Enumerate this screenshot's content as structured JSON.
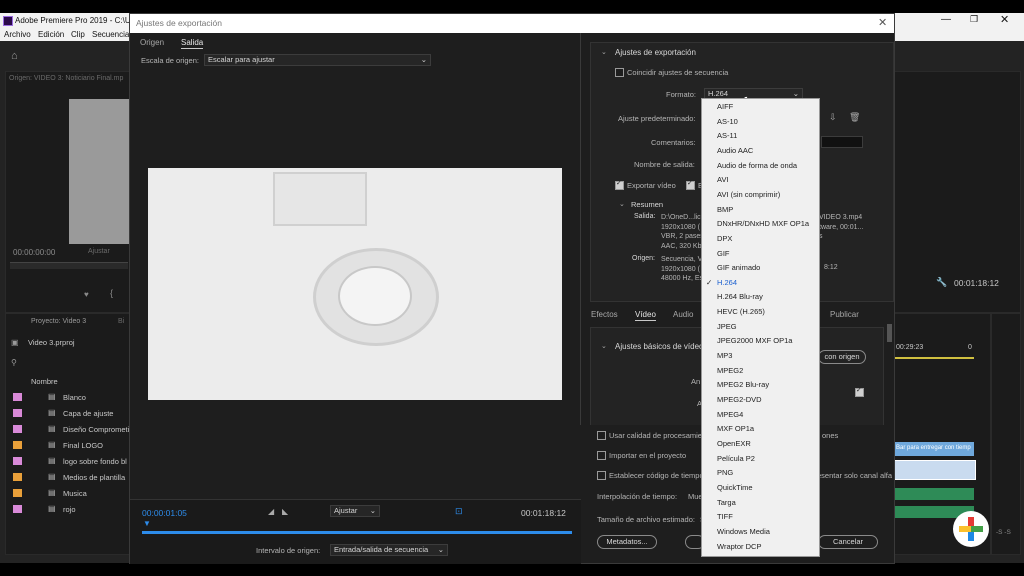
{
  "app": {
    "title": "Adobe Premiere Pro 2019 - C:\\Us",
    "menu": [
      "Archivo",
      "Edición",
      "Clip",
      "Secuencia"
    ],
    "program_monitor_label": "Origen: VIDEO 3: Noticiario Final.mp",
    "timecode_left": "00:00:00:00",
    "fit_left": "Ajustar",
    "timecode_right": "00:01:18:12",
    "project_panel": {
      "tab": "Proyecto: Video 3",
      "tab2": "Bi",
      "file": "Video 3.prproj",
      "column": "Nombre",
      "items": [
        {
          "name": "Blanco",
          "color": "#d98ad8"
        },
        {
          "name": "Capa de ajuste",
          "color": "#d98ad8"
        },
        {
          "name": "Diseño Comprometi",
          "color": "#d98ad8"
        },
        {
          "name": "Final LOGO",
          "color": "#e9a03a"
        },
        {
          "name": "logo sobre fondo bl",
          "color": "#d98ad8"
        },
        {
          "name": "Medios de plantilla",
          "color": "#e9a03a"
        },
        {
          "name": "Musica",
          "color": "#e9a03a"
        },
        {
          "name": "rojo",
          "color": "#d98ad8"
        }
      ]
    },
    "timeline_timecode": "00:29:23",
    "timeline_zero": "0",
    "clip_label": "Bar para entregar con tiemp",
    "meter_value": "-S -S"
  },
  "dialog": {
    "title": "Ajustes de exportación",
    "tabs": [
      "Origen",
      "Salida"
    ],
    "source_scale_label": "Escala de origen:",
    "source_scale_value": "Escalar para ajustar",
    "timecode_in": "00:00:01:05",
    "fit_value": "Ajustar",
    "timecode_out": "00:01:18:12",
    "range_label": "Intervalo de origen:",
    "range_value": "Entrada/salida de secuencia",
    "export_settings": {
      "heading": "Ajustes de exportación",
      "match_sequence": "Coincidir ajustes de secuencia",
      "format_label": "Formato:",
      "format_value": "H.264",
      "preset_label": "Ajuste predeterminado:",
      "comments_label": "Comentarios:",
      "output_name_label": "Nombre de salida:",
      "export_video": "Exportar vídeo",
      "export_audio": "E",
      "summary_heading": "Resumen",
      "output_label": "Salida:",
      "output_lines": [
        "D:\\OneD...lici",
        "1920x1080 (",
        "VBR, 2 pases,",
        "AAC, 320 Kbp"
      ],
      "output_lines_right": [
        "VIDEO 3.mp4",
        "tware, 00:01...",
        "s"
      ],
      "source_label": "Origen:",
      "source_lines": [
        "Secuencia, VI",
        "1920x1080 (",
        "48000 Hz, Es"
      ],
      "source_right": "8:12"
    },
    "lower_tabs": [
      "Efectos",
      "Vídeo",
      "Audio",
      "Publicar"
    ],
    "basic_video_heading": "Ajustes básicos de vídeo",
    "match_source_button": "con origen",
    "row_labels": [
      "An",
      "A"
    ],
    "options": {
      "max_quality": "Usar calidad de procesamien",
      "max_quality_right": "ones",
      "import_project": "Importar en el proyecto",
      "set_timecode": "Establecer código de tiempo",
      "alpha_only": "esentar solo canal alfa",
      "interp_label": "Interpolación de tiempo:",
      "interp_value": "Mue",
      "filesize_label": "Tamaño de archivo estimado:",
      "filesize_value": "S"
    },
    "buttons": {
      "metadata": "Metadatos...",
      "cancel": "Cancelar"
    },
    "format_options": [
      "AIFF",
      "AS-10",
      "AS-11",
      "Audio AAC",
      "Audio de forma de onda",
      "AVI",
      "AVI (sin comprimir)",
      "BMP",
      "DNxHR/DNxHD MXF OP1a",
      "DPX",
      "GIF",
      "GIF animado",
      "H.264",
      "H.264 Blu-ray",
      "HEVC (H.265)",
      "JPEG",
      "JPEG2000 MXF OP1a",
      "MP3",
      "MPEG2",
      "MPEG2 Blu-ray",
      "MPEG2-DVD",
      "MPEG4",
      "MXF OP1a",
      "OpenEXR",
      "Película P2",
      "PNG",
      "QuickTime",
      "Targa",
      "TIFF",
      "Windows Media",
      "Wraptor DCP"
    ],
    "selected_format": "H.264"
  },
  "colors": {
    "accent_blue": "#2d8ceb",
    "selected_text": "#1a5fd0",
    "clip_blue": "#6fa8dc",
    "audio_green": "#2e8b57"
  }
}
